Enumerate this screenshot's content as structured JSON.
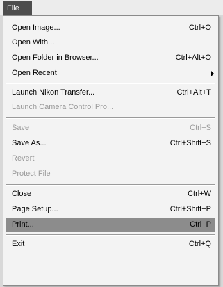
{
  "menubar": {
    "file_label": "File"
  },
  "menu": {
    "items": [
      {
        "label": "Open Image...",
        "shortcut": "Ctrl+O",
        "enabled": true
      },
      {
        "label": "Open With...",
        "shortcut": "",
        "enabled": true
      },
      {
        "label": "Open Folder in Browser...",
        "shortcut": "Ctrl+Alt+O",
        "enabled": true
      },
      {
        "label": "Open Recent",
        "shortcut": "",
        "enabled": true,
        "submenu": true
      },
      {
        "label": "Launch Nikon Transfer...",
        "shortcut": "Ctrl+Alt+T",
        "enabled": true
      },
      {
        "label": "Launch Camera Control Pro...",
        "shortcut": "",
        "enabled": false
      },
      {
        "label": "Save",
        "shortcut": "Ctrl+S",
        "enabled": false
      },
      {
        "label": "Save As...",
        "shortcut": "Ctrl+Shift+S",
        "enabled": true
      },
      {
        "label": "Revert",
        "shortcut": "",
        "enabled": false
      },
      {
        "label": "Protect File",
        "shortcut": "",
        "enabled": false
      },
      {
        "label": "Close",
        "shortcut": "Ctrl+W",
        "enabled": true
      },
      {
        "label": "Page Setup...",
        "shortcut": "Ctrl+Shift+P",
        "enabled": true
      },
      {
        "label": "Print...",
        "shortcut": "Ctrl+P",
        "enabled": true,
        "highlighted": true
      },
      {
        "label": "Exit",
        "shortcut": "Ctrl+Q",
        "enabled": true
      }
    ]
  },
  "colors": {
    "menubar_active": "#4d4d4d",
    "menu_background": "#f3f3f3",
    "highlight": "#8c8c8c",
    "disabled_text": "#9a9a9a"
  }
}
